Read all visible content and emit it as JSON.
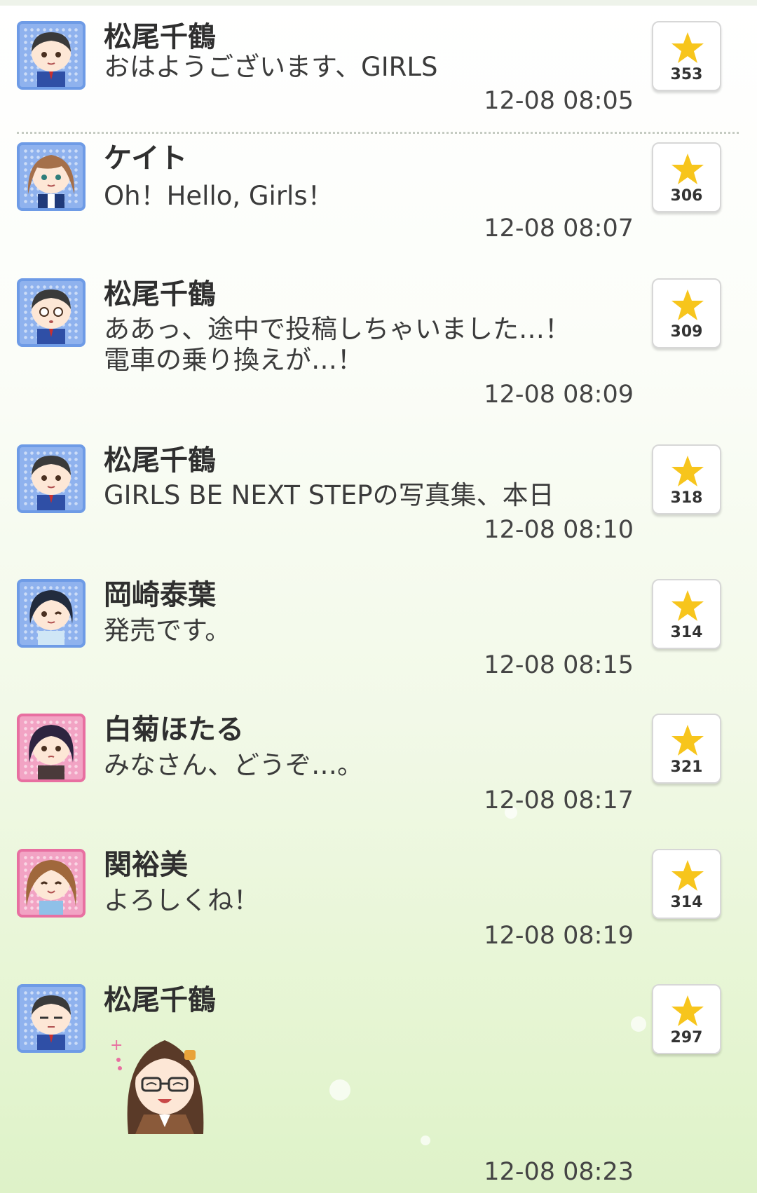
{
  "messages": [
    {
      "name": "松尾千鶴",
      "text": "おはようございます、GIRLS",
      "time": "12-08 08:05",
      "likes": "353",
      "avatar": "blue"
    },
    {
      "name": "ケイト",
      "text": "Oh！Hello, Girls！",
      "time": "12-08 08:07",
      "likes": "306",
      "avatar": "blue"
    },
    {
      "name": "松尾千鶴",
      "text": "ああっ、途中で投稿しちゃいました…！\n電車の乗り換えが…！",
      "time": "12-08 08:09",
      "likes": "309",
      "avatar": "blue"
    },
    {
      "name": "松尾千鶴",
      "text": "GIRLS BE NEXT STEPの写真集、本日",
      "time": "12-08 08:10",
      "likes": "318",
      "avatar": "blue"
    },
    {
      "name": "岡崎泰葉",
      "text": "発売です。",
      "time": "12-08 08:15",
      "likes": "314",
      "avatar": "blue"
    },
    {
      "name": "白菊ほたる",
      "text": "みなさん、どうぞ…。",
      "time": "12-08 08:17",
      "likes": "321",
      "avatar": "pink"
    },
    {
      "name": "関裕美",
      "text": "よろしくね！",
      "time": "12-08 08:19",
      "likes": "314",
      "avatar": "pink"
    },
    {
      "name": "松尾千鶴",
      "text": "",
      "time": "12-08 08:23",
      "likes": "297",
      "avatar": "blue"
    }
  ],
  "colors": {
    "star": "#f7c51c",
    "avatar_blue": "#6e9be6",
    "avatar_pink": "#e86fa1"
  },
  "icons": {
    "like": "star-icon",
    "sticker": "character-sticker"
  }
}
